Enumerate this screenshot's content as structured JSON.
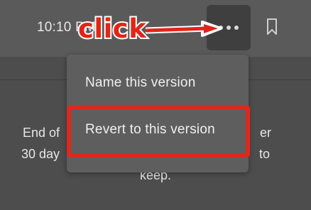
{
  "header": {
    "time_label": "10:10 PM",
    "more_icon": "more-horizontal-icon",
    "bookmark_icon": "bookmark-icon"
  },
  "menu": {
    "items": [
      {
        "label": "Name this version"
      },
      {
        "label": "Revert to this version"
      }
    ]
  },
  "body": {
    "lines": [
      "End of",
      "30 day",
      "keep."
    ],
    "lines_right": [
      "er",
      "to"
    ]
  },
  "annotation": {
    "label": "click",
    "color": "#e32417"
  }
}
